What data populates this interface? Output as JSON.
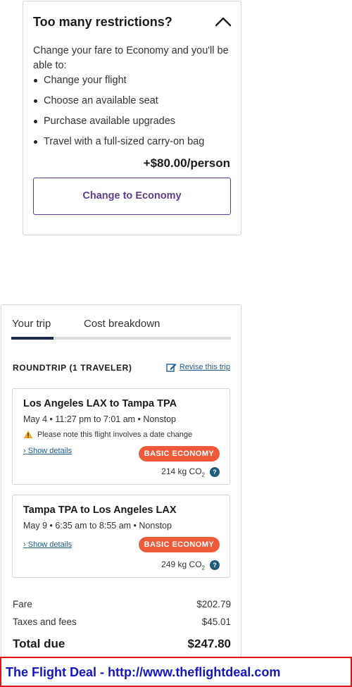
{
  "restrictions": {
    "title": "Too many restrictions?",
    "intro": "Change your fare to Economy and you'll be able to:",
    "benefits": [
      "Change your flight",
      "Choose an available seat",
      "Purchase available upgrades",
      "Travel with a full-sized carry-on bag"
    ],
    "price": "+$80.00/person",
    "button_label": "Change to Economy"
  },
  "trip": {
    "tabs": [
      "Your trip",
      "Cost breakdown"
    ],
    "active_tab": "Your trip",
    "heading": "ROUNDTRIP (1 TRAVELER)",
    "revise_label": "Revise this trip",
    "flights": [
      {
        "route": "Los Angeles LAX to Tampa TPA",
        "times": "May 4 • 11:27 pm to 7:01 am • Nonstop",
        "warning": "Please note this flight involves a date change",
        "details_label": "Show details",
        "fare_badge": "BASIC ECONOMY",
        "co2_value": "214 kg CO",
        "co2_sub": "2"
      },
      {
        "route": "Tampa TPA to Los Angeles LAX",
        "times": "May 9 • 6:35 am to 8:55 am • Nonstop",
        "details_label": "Show details",
        "fare_badge": "BASIC ECONOMY",
        "co2_value": "249 kg CO",
        "co2_sub": "2"
      }
    ],
    "costs": {
      "fare_label": "Fare",
      "fare": "$202.79",
      "taxes_label": "Taxes and fees",
      "taxes": "$45.01",
      "total_label": "Total due",
      "total": "$247.80"
    }
  },
  "banner": {
    "text": "The Flight Deal - http://www.theflightdeal.com"
  },
  "colors": {
    "accent_purple": "#5f3d8f",
    "badge_orange": "#ef5a3a",
    "link_blue": "#1c5a8f",
    "tab_active": "#1d2b4f",
    "banner_border": "#e01616",
    "banner_text": "#1515c8"
  },
  "icons": {
    "collapse": "chevron-up-icon",
    "revise": "edit-icon",
    "warning": "warning-icon",
    "show_details": "chevron-right-icon",
    "co2_help": "help-icon"
  }
}
